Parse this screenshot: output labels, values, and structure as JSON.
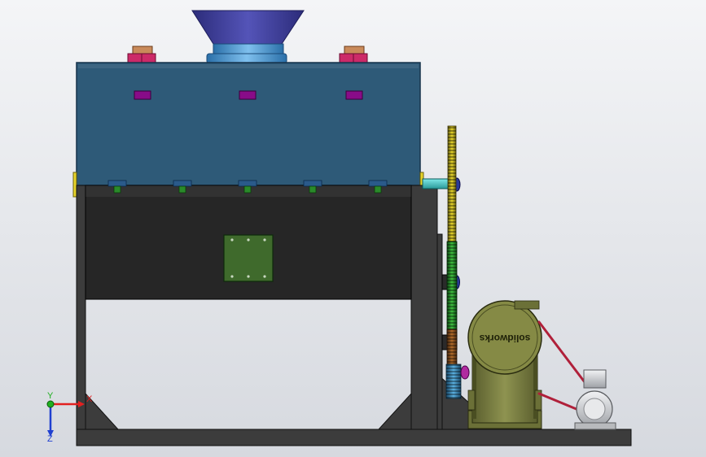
{
  "viewport": {
    "background_top": "#f4f5f7",
    "background_bottom": "#d6d9df"
  },
  "colors": {
    "hopper": "#3f3f9a",
    "tank": "#2e5a78",
    "frame": "#3c3c3c",
    "trough": "#262626",
    "panel": "#3f6a2c",
    "gearbox": "#6b7037",
    "motor": "#d7d9dc",
    "belt": "#b0203a",
    "magenta": "#cc2a68",
    "purple": "#880c88"
  },
  "gearbox": {
    "logo": "solidworks"
  },
  "triad": {
    "x_label": "X",
    "y_label": "Y",
    "z_label": "Z",
    "x_color": "#e22020",
    "y_color": "#20b020",
    "z_color": "#2040d0"
  }
}
